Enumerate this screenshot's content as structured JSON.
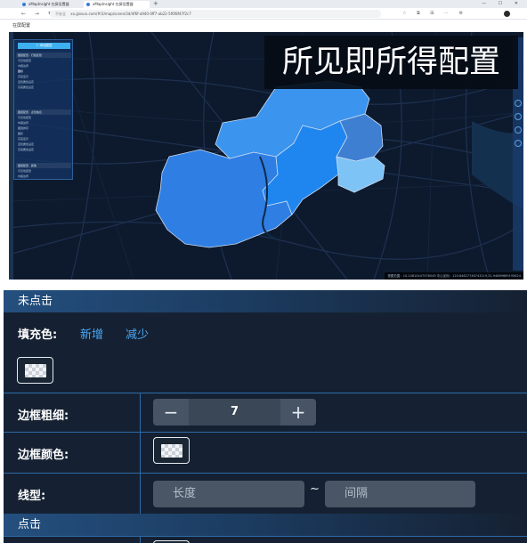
{
  "browser": {
    "tabs": [
      {
        "label": "xMapInsight 在屏设置器"
      },
      {
        "label": "xMapInsight 在屏设置器"
      }
    ],
    "new_tab": "+",
    "url": "xx.gissun.com/#/3/map/scene/3d/4f6f-a940-0ff7-ab22-5f6f8f47f2c7",
    "security_label": "不安全",
    "window_controls": "—  ☐  ✕"
  },
  "app": {
    "title": "在屏配置"
  },
  "screenshot": {
    "caption": "所见即所得配置",
    "coords_text": "视图范围：10.24810447576049 中心坐标：120.64627746743119,31.94669669195624",
    "config_panel": {
      "add_button": "+ 添加图层",
      "sections": [
        {
          "header": "图层配置 · 行政区划",
          "items": [
            "可见性配置",
            "内容边界",
            "图标",
            "高亮显示",
            "显隐属性设定",
            "高亮属性设定"
          ]
        },
        {
          "header": "图层配置 · 点位信息",
          "items": [
            "可见性配置",
            "内容边界",
            "图层排序",
            "图标",
            "高亮显示",
            "显隐属性设定",
            "高亮属性设定"
          ]
        },
        {
          "header": "图层配置 · 其他",
          "items": [
            "可见性配置",
            "内容边界"
          ]
        }
      ]
    }
  },
  "panel": {
    "section_unclicked": "未点击",
    "fill_color_label": "填充色:",
    "add_link": "新增",
    "remove_link": "减少",
    "border_width_label": "边框粗细:",
    "border_width_value": "7",
    "minus": "−",
    "plus": "+",
    "border_color_label": "边框颜色:",
    "line_type_label": "线型:",
    "length_placeholder": "长度",
    "tilde": "~",
    "gap_placeholder": "间隔",
    "section_clicked": "点击"
  },
  "colors": {
    "panel_bg": "#152132",
    "row_border": "#2d6aa8",
    "link": "#4aa8f5",
    "map_bg": "#0d1a2e",
    "region_1": "#2f7ee3",
    "region_2": "#3b94ee",
    "region_3": "#1f86f0",
    "region_4": "#3e7fd2",
    "region_5": "#7ec3f5"
  }
}
